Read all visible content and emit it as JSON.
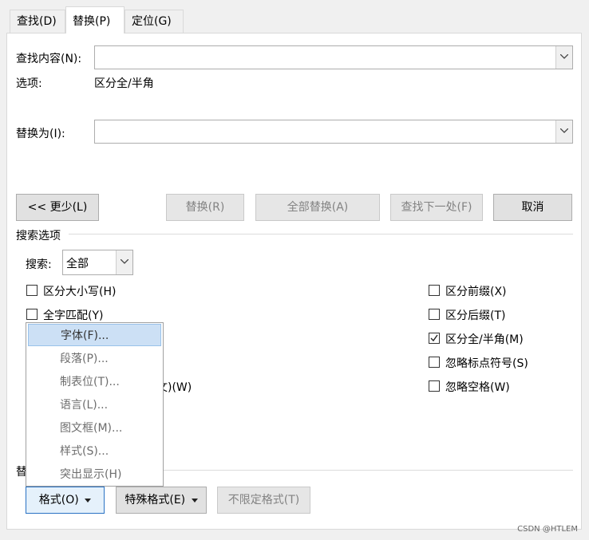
{
  "tabs": [
    {
      "label": "查找(D)"
    },
    {
      "label": "替换(P)"
    },
    {
      "label": "定位(G)"
    }
  ],
  "find": {
    "label": "查找内容(N):",
    "value": ""
  },
  "options": {
    "label": "选项:",
    "value": "区分全/半角"
  },
  "replace": {
    "label": "替换为(I):",
    "value": ""
  },
  "buttons": {
    "less": "<< 更少(L)",
    "replace": "替换(R)",
    "replace_all": "全部替换(A)",
    "find_next": "查找下一处(F)",
    "cancel": "取消"
  },
  "search_options": {
    "heading": "搜索选项",
    "search_label": "搜索:",
    "search_value": "全部",
    "left_checks": [
      {
        "label": "区分大小写(H)",
        "checked": false
      },
      {
        "label": "全字匹配(Y)",
        "checked": false
      }
    ],
    "partial_hidden_label": "文)(W)",
    "right_checks": [
      {
        "label": "区分前缀(X)",
        "checked": false
      },
      {
        "label": "区分后缀(T)",
        "checked": false
      },
      {
        "label": "区分全/半角(M)",
        "checked": true
      },
      {
        "label": "忽略标点符号(S)",
        "checked": false
      },
      {
        "label": "忽略空格(W)",
        "checked": false
      }
    ]
  },
  "replace_section": {
    "heading_partial": "替"
  },
  "format_menu": [
    {
      "label": "字体(F)..."
    },
    {
      "label": "段落(P)..."
    },
    {
      "label": "制表位(T)..."
    },
    {
      "label": "语言(L)..."
    },
    {
      "label": "图文框(M)..."
    },
    {
      "label": "样式(S)..."
    },
    {
      "label": "突出显示(H)"
    }
  ],
  "bottom_buttons": {
    "format": "格式(O)",
    "special": "特殊格式(E)",
    "no_format": "不限定格式(T)"
  },
  "watermark": "CSDN @HTLEM"
}
